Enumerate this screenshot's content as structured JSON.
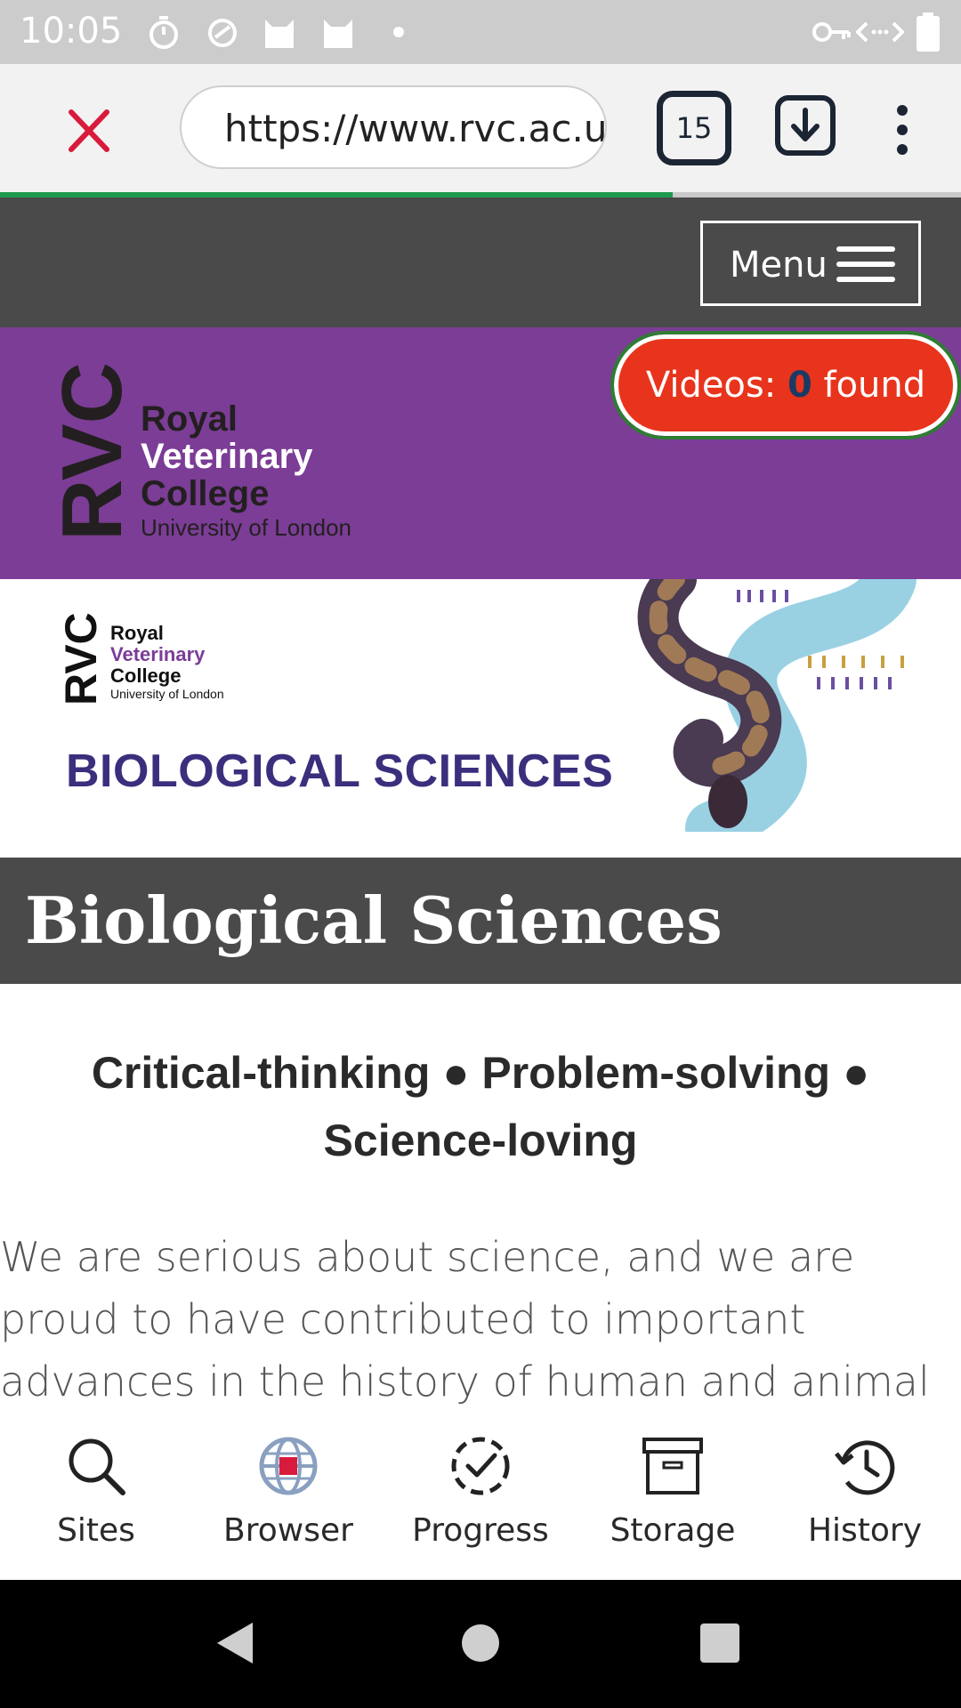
{
  "status_bar": {
    "time": "10:05",
    "left_icons": [
      "timer-icon",
      "sync-icon",
      "cat-icon",
      "cat-icon",
      "dot-icon"
    ],
    "right_icons": [
      "vpn-key-icon",
      "data-transfer-icon",
      "battery-icon"
    ]
  },
  "browser": {
    "url": "https://www.rvc.ac.uk",
    "tab_count": "15",
    "page_load_progress": 0.7,
    "progress_color": "#1e9a50"
  },
  "site": {
    "menu_label": "Menu",
    "videos_prefix": "Videos:",
    "videos_count": "0",
    "videos_suffix": "found",
    "logo_lines": [
      "RVC",
      "Royal",
      "Veterinary",
      "College",
      "University of London"
    ],
    "banner_subject": "BIOLOGICAL SCIENCES",
    "page_title": "Biological Sciences",
    "tagline": "Critical-thinking ● Problem-solving ● Science-loving",
    "intro": "We are serious about science, and we are proud to have contributed to important advances in the history of human and animal medicine,",
    "colors": {
      "purple": "#7b3d96",
      "dark_band": "#4a4a4a",
      "videos_button": "#e8341c",
      "subject_text": "#3a2f7d"
    }
  },
  "app_nav": {
    "items": [
      {
        "label": "Sites",
        "icon": "search-icon"
      },
      {
        "label": "Browser",
        "icon": "globe-icon"
      },
      {
        "label": "Progress",
        "icon": "progress-check-icon"
      },
      {
        "label": "Storage",
        "icon": "archive-box-icon"
      },
      {
        "label": "History",
        "icon": "history-icon"
      }
    ]
  },
  "system_nav": [
    "back-icon",
    "home-icon",
    "recents-icon"
  ]
}
